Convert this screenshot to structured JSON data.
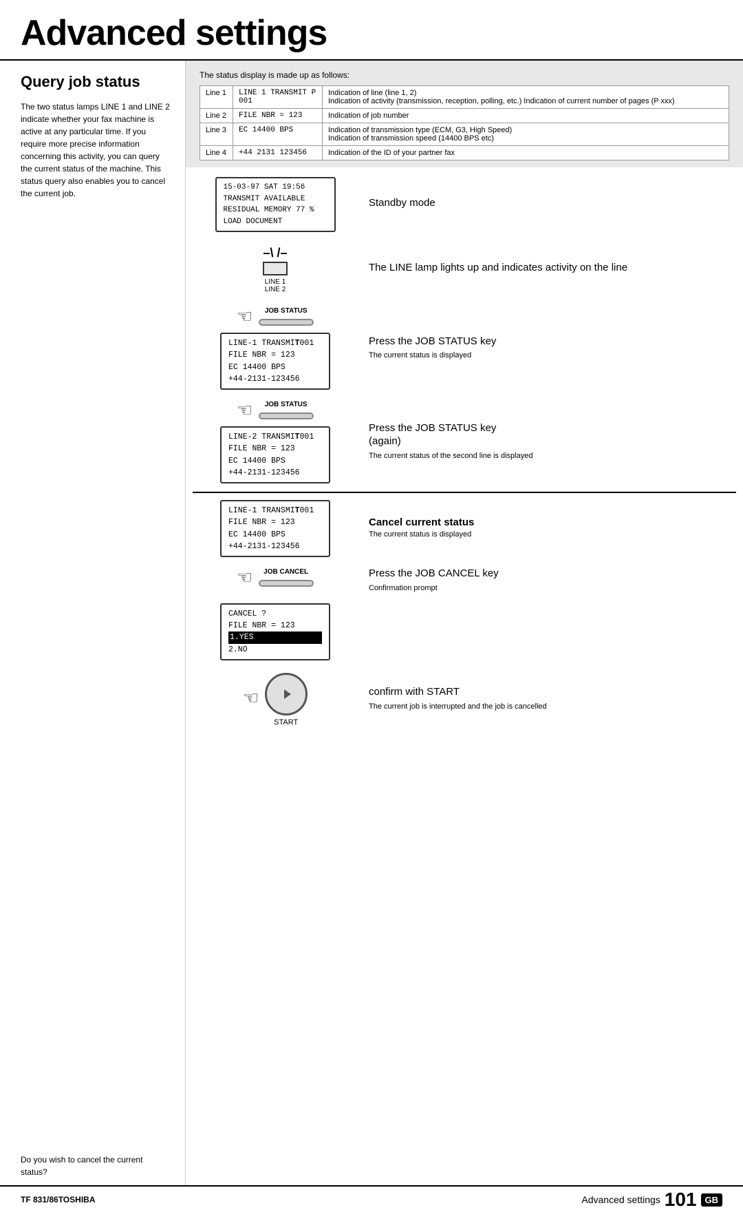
{
  "header": {
    "title": "Advanced settings"
  },
  "left": {
    "section_title": "Query job status",
    "body_text": "The two status lamps LINE 1 and LINE 2 indicate whether your fax machine is active at any particular time. If you require more precise information concerning this activity, you can query the current status of the machine. This status query also enables you to cancel the current job.",
    "cancel_text": "Do you wish to cancel the current status?"
  },
  "status_table": {
    "title": "The status display is made up as follows:",
    "rows": [
      {
        "line": "Line 1",
        "content": "LINE 1 TRANSMIT P 001",
        "desc": "Indication of line (line 1, 2)\nIndication of activity (transmission, reception, polling, etc.) Indication of current number of pages (P xxx)"
      },
      {
        "line": "Line 2",
        "content": "FILE NBR = 123",
        "desc": "Indication of job number"
      },
      {
        "line": "Line 3",
        "content": "EC 14400 BPS",
        "desc": "Indication of transmission type (ECM, G3, High Speed)\nIndication of transmission speed (14400 BPS etc)"
      },
      {
        "line": "Line 4",
        "content": "+44 2131 123456",
        "desc": "Indication of the ID of your partner fax"
      }
    ]
  },
  "steps": {
    "standby": {
      "display_lines": [
        "15-03-97  SAT  19:56",
        "TRANSMIT AVAILABLE",
        "RESIDUAL MEMORY 77 %",
        "LOAD DOCUMENT"
      ],
      "label": "Standby mode"
    },
    "line_lamp": {
      "desc": "The LINE lamp lights up and indicates activity on the line",
      "line1": "LINE 1",
      "line2": "LINE 2"
    },
    "job_status_1": {
      "key_label": "JOB STATUS",
      "heading": "Press the JOB STATUS key",
      "subtext": "The current status is displayed",
      "display_lines": [
        "LINE-1   TRANSMIT001",
        "FILE NBR =    123",
        "EC 14400 BPS",
        "+44-2131-123456"
      ]
    },
    "job_status_2": {
      "key_label": "JOB STATUS",
      "heading": "Press the JOB STATUS key\n(again)",
      "subtext": "The current status of the second line is displayed",
      "display_lines": [
        "LINE-2   TRANSMIT001",
        "FILE NBR =    123",
        "EC 14400 BPS",
        "+44-2131-123456"
      ]
    },
    "cancel_status": {
      "heading": "Cancel current status",
      "subtext": "The current status is displayed",
      "display_lines": [
        "LINE-1   TRANSMIT001",
        "FILE NBR =    123",
        "EC 14400 BPS",
        "+44-2131-123456"
      ]
    },
    "job_cancel": {
      "key_label": "JOB CANCEL",
      "heading": "Press the JOB CANCEL key",
      "subtext": "Confirmation prompt",
      "display_lines": [
        "CANCEL ?",
        "FILE NBR =    123",
        "1.YES",
        "2.NO"
      ],
      "highlight_row": 2
    },
    "confirm_start": {
      "heading": "confirm with START",
      "subtext": "The current job is interrupted and the job is cancelled",
      "start_label": "START"
    }
  },
  "footer": {
    "left": "TF 831/86TOSHIBA",
    "right_text": "Advanced settings",
    "page_num": "101",
    "badge": "GB"
  }
}
